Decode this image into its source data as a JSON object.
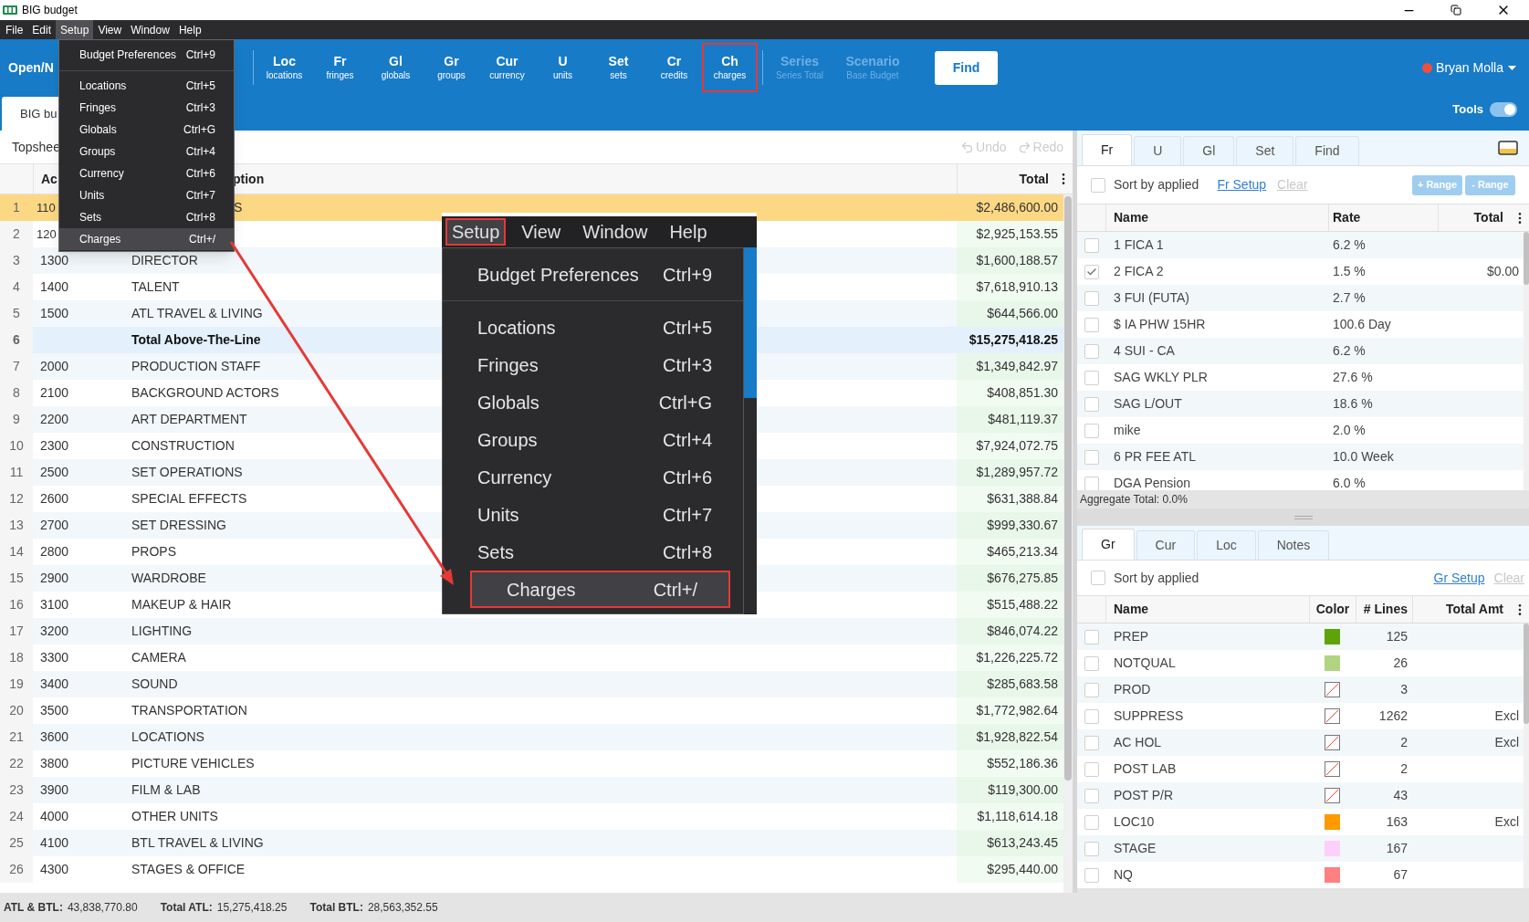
{
  "window": {
    "title": "BIG budget"
  },
  "menu_bar": [
    {
      "label": "File",
      "selected": false
    },
    {
      "label": "Edit",
      "selected": false
    },
    {
      "label": "Setup",
      "selected": true
    },
    {
      "label": "View",
      "selected": false
    },
    {
      "label": "Window",
      "selected": false
    },
    {
      "label": "Help",
      "selected": false
    }
  ],
  "toolbar": {
    "open_label": "Open/N",
    "items": [
      {
        "abbr": "Loc",
        "label": "locations",
        "highlighted": false,
        "disabled": false
      },
      {
        "abbr": "Fr",
        "label": "fringes",
        "highlighted": false,
        "disabled": false
      },
      {
        "abbr": "Gl",
        "label": "globals",
        "highlighted": false,
        "disabled": false
      },
      {
        "abbr": "Gr",
        "label": "groups",
        "highlighted": false,
        "disabled": false
      },
      {
        "abbr": "Cur",
        "label": "currency",
        "highlighted": false,
        "disabled": false
      },
      {
        "abbr": "U",
        "label": "units",
        "highlighted": false,
        "disabled": false
      },
      {
        "abbr": "Set",
        "label": "sets",
        "highlighted": false,
        "disabled": false
      },
      {
        "abbr": "Cr",
        "label": "credits",
        "highlighted": false,
        "disabled": false
      },
      {
        "abbr": "Ch",
        "label": "charges",
        "highlighted": true,
        "disabled": false
      }
    ],
    "series_items": [
      {
        "abbr": "Series",
        "label": "Series Total",
        "disabled": true
      },
      {
        "abbr": "Scenario",
        "label": "Base Budget",
        "disabled": true
      }
    ],
    "find_button": "Find",
    "user": {
      "name": "Bryan Molla",
      "color": "#f04e3e"
    },
    "tools": {
      "label": "Tools",
      "on": true
    }
  },
  "document_tabs": [
    {
      "label": "BIG bu",
      "selected": true
    }
  ],
  "topsheet": {
    "title": "Topshee",
    "undo": {
      "label": "Undo",
      "disabled": true
    },
    "redo": {
      "label": "Redo",
      "disabled": true
    },
    "columns": [
      {
        "label": "Ac"
      },
      {
        "label": "ption",
        "cut_by_menu": true
      },
      {
        "label": "Total"
      }
    ],
    "rows": [
      {
        "number": "1",
        "account": "110",
        "description": "S",
        "total": "$2,486,600.00",
        "selected": true,
        "cut_by_menu": true,
        "kind": "line"
      },
      {
        "number": "2",
        "account": "120",
        "total": "$2,925,153.55",
        "selected": false,
        "cut_by_menu": true,
        "kind": "line"
      },
      {
        "number": "3",
        "account": "1300",
        "description": "DIRECTOR",
        "total": "$1,600,188.57",
        "selected": false,
        "kind": "line"
      },
      {
        "number": "4",
        "account": "1400",
        "description": "TALENT",
        "total": "$7,618,910.13",
        "selected": false,
        "kind": "line"
      },
      {
        "number": "5",
        "account": "1500",
        "description": "ATL TRAVEL & LIVING",
        "total": "$644,566.00",
        "selected": false,
        "kind": "line"
      },
      {
        "number": "6",
        "description": "Total Above-The-Line",
        "total": "$15,275,418.25",
        "selected": false,
        "kind": "subtotal"
      },
      {
        "number": "7",
        "account": "2000",
        "description": "PRODUCTION STAFF",
        "total": "$1,349,842.97",
        "selected": false,
        "kind": "line"
      },
      {
        "number": "8",
        "account": "2100",
        "description": "BACKGROUND ACTORS",
        "total": "$408,851.30",
        "selected": false,
        "kind": "line"
      },
      {
        "number": "9",
        "account": "2200",
        "description": "ART DEPARTMENT",
        "total": "$481,119.37",
        "selected": false,
        "kind": "line"
      },
      {
        "number": "10",
        "account": "2300",
        "description": "CONSTRUCTION",
        "total": "$7,924,072.75",
        "selected": false,
        "kind": "line"
      },
      {
        "number": "11",
        "account": "2500",
        "description": "SET OPERATIONS",
        "total": "$1,289,957.72",
        "selected": false,
        "kind": "line"
      },
      {
        "number": "12",
        "account": "2600",
        "description": "SPECIAL EFFECTS",
        "total": "$631,388.84",
        "selected": false,
        "kind": "line"
      },
      {
        "number": "13",
        "account": "2700",
        "description": "SET DRESSING",
        "total": "$999,330.67",
        "selected": false,
        "kind": "line"
      },
      {
        "number": "14",
        "account": "2800",
        "description": "PROPS",
        "total": "$465,213.34",
        "selected": false,
        "kind": "line"
      },
      {
        "number": "15",
        "account": "2900",
        "description": "WARDROBE",
        "total": "$676,275.85",
        "selected": false,
        "kind": "line"
      },
      {
        "number": "16",
        "account": "3100",
        "description": "MAKEUP & HAIR",
        "total": "$515,488.22",
        "selected": false,
        "kind": "line"
      },
      {
        "number": "17",
        "account": "3200",
        "description": "LIGHTING",
        "total": "$846,074.22",
        "selected": false,
        "kind": "line"
      },
      {
        "number": "18",
        "account": "3300",
        "description": "CAMERA",
        "total": "$1,226,225.72",
        "selected": false,
        "kind": "line"
      },
      {
        "number": "19",
        "account": "3400",
        "description": "SOUND",
        "total": "$285,683.58",
        "selected": false,
        "kind": "line"
      },
      {
        "number": "20",
        "account": "3500",
        "description": "TRANSPORTATION",
        "total": "$1,772,982.64",
        "selected": false,
        "kind": "line"
      },
      {
        "number": "21",
        "account": "3600",
        "description": "LOCATIONS",
        "total": "$1,928,822.54",
        "selected": false,
        "kind": "line"
      },
      {
        "number": "22",
        "account": "3800",
        "description": "PICTURE VEHICLES",
        "total": "$552,186.36",
        "selected": false,
        "kind": "line"
      },
      {
        "number": "23",
        "account": "3900",
        "description": "FILM & LAB",
        "total": "$119,300.00",
        "selected": false,
        "kind": "line"
      },
      {
        "number": "24",
        "account": "4000",
        "description": "OTHER UNITS",
        "total": "$1,118,614.18",
        "selected": false,
        "kind": "line"
      },
      {
        "number": "25",
        "account": "4100",
        "description": "BTL TRAVEL & LIVING",
        "total": "$613,243.45",
        "selected": false,
        "kind": "line"
      },
      {
        "number": "26",
        "account": "4300",
        "description": "STAGES & OFFICE",
        "total": "$295,440.00",
        "selected": false,
        "kind": "line"
      }
    ]
  },
  "fringes_panel": {
    "tabs": [
      {
        "label": "Fr",
        "selected": true
      },
      {
        "label": "U",
        "selected": false
      },
      {
        "label": "Gl",
        "selected": false
      },
      {
        "label": "Set",
        "selected": false
      },
      {
        "label": "Find",
        "selected": false
      }
    ],
    "sort": {
      "label": "Sort by applied",
      "checked": false
    },
    "setup_link": "Fr Setup",
    "clear_link": {
      "label": "Clear",
      "disabled": true
    },
    "range_buttons": [
      {
        "label": "+ Range",
        "disabled": true
      },
      {
        "label": "- Range",
        "disabled": true
      }
    ],
    "columns": [
      "Name",
      "Rate",
      "Total"
    ],
    "rows": [
      {
        "checked": false,
        "name": "1 FICA 1",
        "rate": "6.2 %"
      },
      {
        "checked": true,
        "name": "2 FICA 2",
        "rate": "1.5 %",
        "total": "$0.00"
      },
      {
        "checked": false,
        "name": "3 FUI (FUTA)",
        "rate": "2.7 %"
      },
      {
        "checked": false,
        "name": "$ IA PHW 15HR",
        "rate": "100.6 Day"
      },
      {
        "checked": false,
        "name": "4 SUI - CA",
        "rate": "6.2 %"
      },
      {
        "checked": false,
        "name": "SAG WKLY PLR",
        "rate": "27.6 %"
      },
      {
        "checked": false,
        "name": "SAG L/OUT",
        "rate": "18.6 %"
      },
      {
        "checked": false,
        "name": "mike",
        "rate": "2.0 %"
      },
      {
        "checked": false,
        "name": "6 PR FEE ATL",
        "rate": "10.0 Week"
      },
      {
        "checked": false,
        "name": "DGA Pension",
        "rate": "6.0 %"
      }
    ],
    "aggregate": "Aggregate Total: 0.0%"
  },
  "groups_panel": {
    "tabs": [
      {
        "label": "Gr",
        "selected": true
      },
      {
        "label": "Cur",
        "selected": false
      },
      {
        "label": "Loc",
        "selected": false
      },
      {
        "label": "Notes",
        "selected": false
      }
    ],
    "sort": {
      "label": "Sort by applied",
      "checked": false
    },
    "setup_link": "Gr Setup",
    "clear_link": {
      "label": "Clear",
      "disabled": true
    },
    "columns": [
      "Name",
      "Color",
      "# Lines",
      "Total Amt"
    ],
    "rows": [
      {
        "checked": false,
        "name": "PREP",
        "color": "#5fa30a",
        "lines": "125"
      },
      {
        "checked": false,
        "name": "NOTQUAL",
        "color": "#b0d481",
        "lines": "26"
      },
      {
        "checked": false,
        "name": "PROD",
        "lines": "3"
      },
      {
        "checked": false,
        "name": "SUPPRESS",
        "lines": "1262",
        "total": "Excl"
      },
      {
        "checked": false,
        "name": "AC HOL",
        "lines": "2",
        "total": "Excl"
      },
      {
        "checked": false,
        "name": "POST LAB",
        "lines": "2"
      },
      {
        "checked": false,
        "name": "POST P/R",
        "lines": "43"
      },
      {
        "checked": false,
        "name": "LOC10",
        "color": "#ff9900",
        "lines": "163",
        "total": "Excl"
      },
      {
        "checked": false,
        "name": "STAGE",
        "color": "#fdd0fb",
        "lines": "167"
      },
      {
        "checked": false,
        "name": "NQ",
        "color": "#ff8080",
        "lines": "67"
      }
    ]
  },
  "status_bar": [
    {
      "label": "ATL & BTL:",
      "value": "43,838,770.80"
    },
    {
      "label": "Total ATL:",
      "value": "15,275,418.25"
    },
    {
      "label": "Total BTL:",
      "value": "28,563,352.55"
    }
  ],
  "setup_menu": {
    "items": [
      {
        "label": "Budget Preferences",
        "shortcut": "Ctrl+9",
        "selected": false,
        "separator_after": true
      },
      {
        "label": "Locations",
        "shortcut": "Ctrl+5",
        "selected": false
      },
      {
        "label": "Fringes",
        "shortcut": "Ctrl+3",
        "selected": false
      },
      {
        "label": "Globals",
        "shortcut": "Ctrl+G",
        "selected": false
      },
      {
        "label": "Groups",
        "shortcut": "Ctrl+4",
        "selected": false
      },
      {
        "label": "Currency",
        "shortcut": "Ctrl+6",
        "selected": false
      },
      {
        "label": "Units",
        "shortcut": "Ctrl+7",
        "selected": false
      },
      {
        "label": "Sets",
        "shortcut": "Ctrl+8",
        "selected": false
      },
      {
        "label": "Charges",
        "shortcut": "Ctrl+/",
        "selected": true
      }
    ]
  },
  "zoom_inset": {
    "menu_bar": [
      {
        "label": "Setup",
        "highlighted": true
      },
      {
        "label": "View",
        "highlighted": false
      },
      {
        "label": "Window",
        "highlighted": false
      },
      {
        "label": "Help",
        "highlighted": false
      }
    ],
    "items": [
      {
        "label": "Budget Preferences",
        "shortcut": "Ctrl+9",
        "highlighted": false,
        "separator_after": true
      },
      {
        "label": "Locations",
        "shortcut": "Ctrl+5",
        "highlighted": false
      },
      {
        "label": "Fringes",
        "shortcut": "Ctrl+3",
        "highlighted": false
      },
      {
        "label": "Globals",
        "shortcut": "Ctrl+G",
        "highlighted": false
      },
      {
        "label": "Groups",
        "shortcut": "Ctrl+4",
        "highlighted": false
      },
      {
        "label": "Currency",
        "shortcut": "Ctrl+6",
        "highlighted": false
      },
      {
        "label": "Units",
        "shortcut": "Ctrl+7",
        "highlighted": false
      },
      {
        "label": "Sets",
        "shortcut": "Ctrl+8",
        "highlighted": false
      },
      {
        "label": "Charges",
        "shortcut": "Ctrl+/",
        "highlighted": true
      }
    ]
  }
}
